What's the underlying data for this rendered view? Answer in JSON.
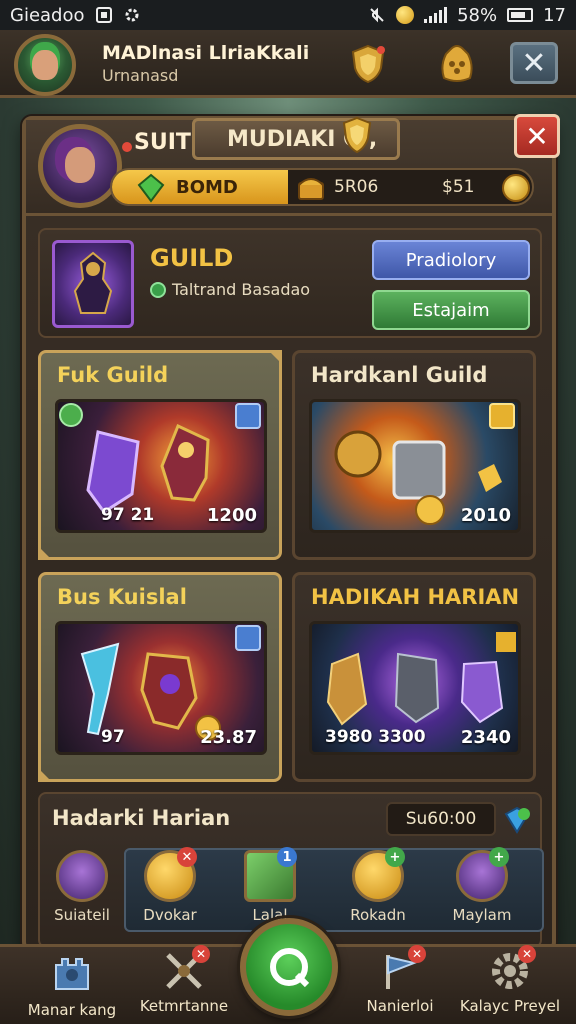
{
  "status": {
    "carrier": "Gieadoo",
    "battery_text": "58%",
    "time": "17"
  },
  "topbar": {
    "player_name": "MADlnasi LlriaKkali",
    "player_sub": "Urnanasd",
    "close_label": "✕"
  },
  "panel": {
    "suit_label": "SUIT",
    "title": "MUDIAKI G ,",
    "close_label": "✕",
    "resources": {
      "fill_fraction": 0.42,
      "value1": "BOMD",
      "value2": "5R06",
      "value3": "$51"
    }
  },
  "guild": {
    "title": "GUILD",
    "status": "Taltrand Basadao",
    "btn_primary": "Pradiolory",
    "btn_secondary": "Estajaim"
  },
  "tiles": [
    {
      "title": "Fuk Guild",
      "stats_left": "97 21",
      "stats_right": "1200",
      "selected": true
    },
    {
      "title": "Hardkanl Guild",
      "stats_left": "",
      "stats_right": "2010",
      "selected": false
    },
    {
      "title": "Bus Kuislal",
      "stats_left": "97",
      "stats_right": "23.87",
      "selected": true
    },
    {
      "title": "HADIKAH HARIAN",
      "stats_left": "3980  3300",
      "stats_right": "2340",
      "selected": false
    }
  ],
  "daily": {
    "title": "Hadarki Harian",
    "timer": "Su60:00",
    "rewards": [
      {
        "label": "Suiateil",
        "tag": "",
        "tag_color": ""
      },
      {
        "label": "Dvokar",
        "tag": "✕",
        "tag_color": "red"
      },
      {
        "label": "Lalal",
        "tag": "1",
        "tag_color": "blue"
      },
      {
        "label": "Rokadn",
        "tag": "+",
        "tag_color": "green"
      },
      {
        "label": "Maylam",
        "tag": "+",
        "tag_color": "green"
      }
    ]
  },
  "nav": {
    "item1": "Manar kang",
    "item2": "Ketmrtanne",
    "item3": "Nanierloi",
    "item4": "Kalayc Preyel"
  },
  "colors": {
    "accent_gold": "#f2c244",
    "panel_border": "#6b5336",
    "primary_button": "#3f57a8",
    "secondary_button": "#2f7a35",
    "close_red": "#d84a3c"
  }
}
